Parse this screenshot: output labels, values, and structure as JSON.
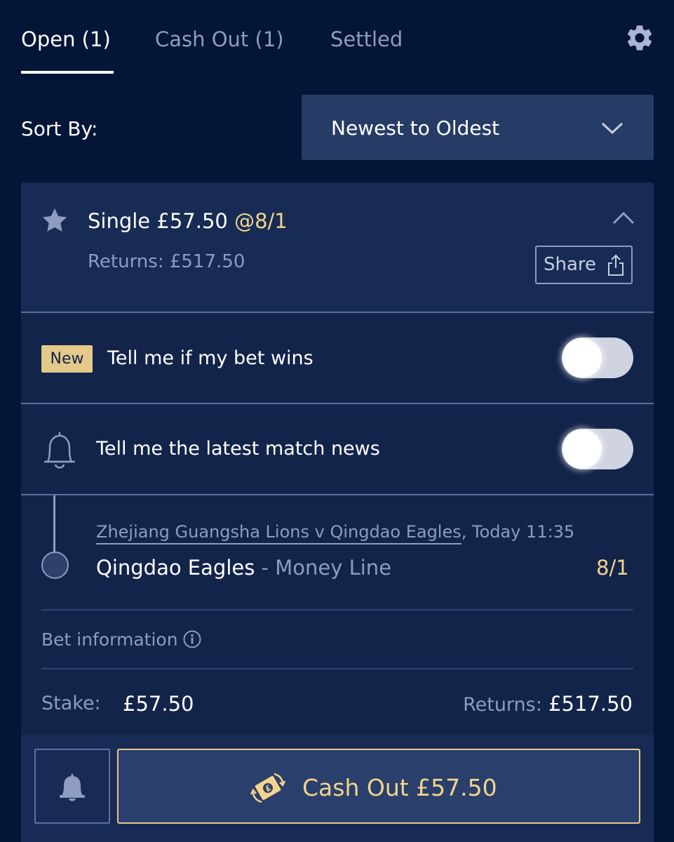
{
  "tabs": {
    "open": "Open (1)",
    "cash_out": "Cash Out (1)",
    "settled": "Settled"
  },
  "sort": {
    "label": "Sort By:",
    "selected": "Newest to Oldest"
  },
  "bet": {
    "title": "Single £57.50",
    "odds": "@8/1",
    "returns": "Returns: £517.50",
    "share_label": "Share",
    "notify_badge": "New",
    "notify_win_label": "Tell me if my bet wins",
    "notify_win_on": false,
    "notify_news_label": "Tell me the latest match news",
    "notify_news_on": false,
    "event": "Zhejiang Guangsha Lions v Qingdao Eagles",
    "event_time": ", Today 11:35",
    "selection": "Qingdao Eagles",
    "market": " - Money Line",
    "selection_odds": "8/1",
    "bet_information": "Bet information",
    "stake_label": "Stake:",
    "stake_value": "£57.50",
    "returns_label": "Returns:",
    "returns_value": "£517.50",
    "cash_out_label": "Cash Out £57.50"
  },
  "colors": {
    "background": "#041638",
    "card": "#13244a",
    "accent_gold": "#f2d48b",
    "muted_text": "#8d9cc0"
  },
  "icons": {
    "settings": "gear-icon",
    "sort": "chevron-down-icon",
    "favourite": "star-icon",
    "collapse": "chevron-up-icon",
    "share": "share-icon",
    "news": "bell-outline-icon",
    "info": "info-icon",
    "alert": "bell-icon",
    "cash_out": "cash-out-icon"
  }
}
